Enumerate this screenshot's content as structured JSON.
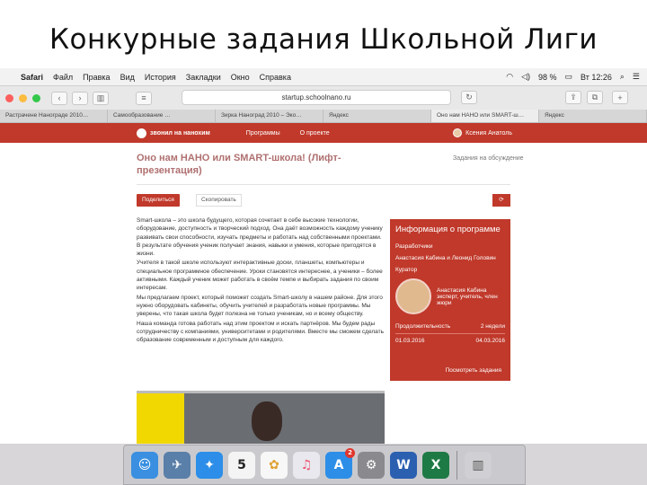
{
  "slide": {
    "title": "Конкурные задания Школьной Лиги"
  },
  "menubar": {
    "app": "Safari",
    "items": [
      "Файл",
      "Правка",
      "Вид",
      "История",
      "Закладки",
      "Окно",
      "Справка"
    ],
    "battery": "98 %",
    "clock": "Вт 12:26"
  },
  "toolbar": {
    "url": "startup.schoolnano.ru",
    "back": "‹",
    "forward": "›"
  },
  "tabs": [
    "Растрачене Нанограде 2010…",
    "Самообразование …",
    "Зирка Наноград 2010 – Эко…",
    "Яндекс",
    "Оно нам НАНО или SMART-ш…",
    "Яндекс"
  ],
  "site": {
    "logo_text": "звонил на нанохим",
    "nav": [
      "Программы",
      "О проекте"
    ],
    "user": "Ксения Анатоль",
    "heading": "Оно нам НАНО или SMART-школа! (Лифт-презентация)",
    "aside_link": "Задания на обсуждение",
    "share_button": "Поделиться",
    "copy_button": "Скопировать",
    "small_button": "⟳",
    "article": [
      "Smart-школа – это школа будущего, которая сочетает в себе высокие технологии, оборудование, доступность и творческий подход. Она даёт возможность каждому ученику развивать свои способности, изучать предметы и работать над собственными проектами. В результате обучения ученик получает знания, навыки и умения, которые пригодятся в жизни.",
      "Учителя в такой школе используют интерактивные доски, планшеты, компьютеры и специальное программное обеспечение. Уроки становятся интереснее, а ученики – более активными. Каждый ученик может работать в своём темпе и выбирать задания по своим интересам.",
      "Мы предлагаем проект, который поможет создать Smart-школу в нашем районе. Для этого нужно оборудовать кабинеты, обучить учителей и разработать новые программы. Мы уверены, что такая школа будет полезна не только ученикам, но и всему обществу.",
      "Наша команда готова работать над этим проектом и искать партнёров. Мы будем рады сотрудничеству с компаниями, университетами и родителями. Вместе мы сможем сделать образование современным и доступным для каждого."
    ],
    "info": {
      "title": "Информация о программе",
      "role_label": "Разработчики",
      "role_value": "Анастасия Кабина и Леонид Головин",
      "curator_label": "Куратор",
      "curator_name": "Анастасия Кабина эксперт, учитель, член жюри",
      "duration_label": "Продолжительность",
      "duration_value": "2 недели",
      "date_start": "01.03.2016",
      "date_end": "04.03.2016",
      "footer_link": "Посмотреть задания"
    }
  },
  "dock": {
    "apps": [
      {
        "name": "finder-icon",
        "glyph": "☺",
        "color": "#3a8fe0"
      },
      {
        "name": "preview-icon",
        "glyph": "✈",
        "color": "#5a7fa8"
      },
      {
        "name": "safari-icon",
        "glyph": "✦",
        "color": "#2c8ee8"
      },
      {
        "name": "calendar-icon",
        "glyph": "5",
        "color": "#f4f4f4"
      },
      {
        "name": "photos-icon",
        "glyph": "✿",
        "color": "#f7f7f7"
      },
      {
        "name": "music-icon",
        "glyph": "♫",
        "color": "#e8e8ee"
      },
      {
        "name": "app-store-icon",
        "glyph": "A",
        "color": "#2d8ee8"
      },
      {
        "name": "system-preferences-icon",
        "glyph": "⚙",
        "color": "#8a8a8e"
      },
      {
        "name": "word-icon",
        "glyph": "W",
        "color": "#2b5fb0"
      },
      {
        "name": "excel-icon",
        "glyph": "X",
        "color": "#1e7a45"
      },
      {
        "name": "trash-icon",
        "glyph": "🗑",
        "color": "#d0d0d4"
      }
    ],
    "app_store_badge": "2"
  }
}
